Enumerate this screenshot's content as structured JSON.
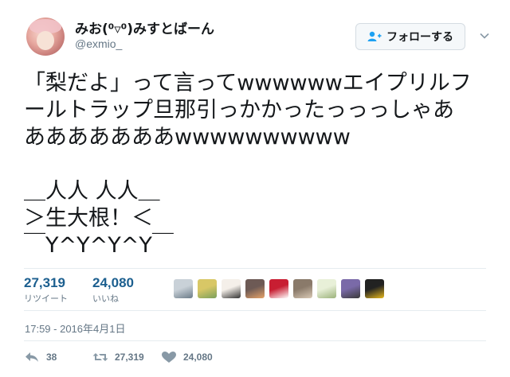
{
  "user": {
    "display_name": "みお(⁰▿⁰)みすとばーん",
    "handle": "@exmio_"
  },
  "follow_button": {
    "label": "フォローする",
    "icon": "add-user-icon"
  },
  "more_menu": {
    "icon": "chevron-down-icon"
  },
  "tweet": {
    "text": "「梨だよ」って言ってwwwwwwエイプリルフ\nールトラップ旦那引っかかったっっっしゃあ\nあああああああwwwwwwwwww\n\n＿人人 人人＿\n＞生大根！＜\n￣Y^Y^Y^Y￣"
  },
  "stats": {
    "retweets": {
      "value": "27,319",
      "label": "リツイート"
    },
    "likes": {
      "value": "24,080",
      "label": "いいね"
    }
  },
  "likers_thumbnails": [
    {
      "name": "default-avatar",
      "colors": [
        "#c9d1d8",
        "#6b7b88"
      ]
    },
    {
      "name": "anime-avatar-1",
      "colors": [
        "#d8c766",
        "#7aa05b"
      ]
    },
    {
      "name": "person-avatar",
      "colors": [
        "#f4efe9",
        "#333333"
      ]
    },
    {
      "name": "sunset-avatar",
      "colors": [
        "#6d5a55",
        "#e6a369"
      ]
    },
    {
      "name": "red-icon-avatar",
      "colors": [
        "#c81e32",
        "#ffffff"
      ]
    },
    {
      "name": "photo-avatar",
      "colors": [
        "#8a7a6a",
        "#d9c9b5"
      ]
    },
    {
      "name": "anime-avatar-2",
      "colors": [
        "#e8f0d8",
        "#9bb27a"
      ]
    },
    {
      "name": "robot-avatar",
      "colors": [
        "#7a6aa8",
        "#3a3a3a"
      ]
    },
    {
      "name": "game-avatar",
      "colors": [
        "#222222",
        "#e8b91e"
      ]
    }
  ],
  "timestamp": "17:59 - 2016年4月1日",
  "actions": {
    "reply": {
      "count": "38",
      "icon": "reply-icon"
    },
    "retweet": {
      "count": "27,319",
      "icon": "retweet-icon"
    },
    "like": {
      "count": "24,080",
      "icon": "heart-icon"
    }
  },
  "colors": {
    "accent": "#1c5f8f",
    "muted": "#657786",
    "follow_icon": "#1da1f2"
  }
}
